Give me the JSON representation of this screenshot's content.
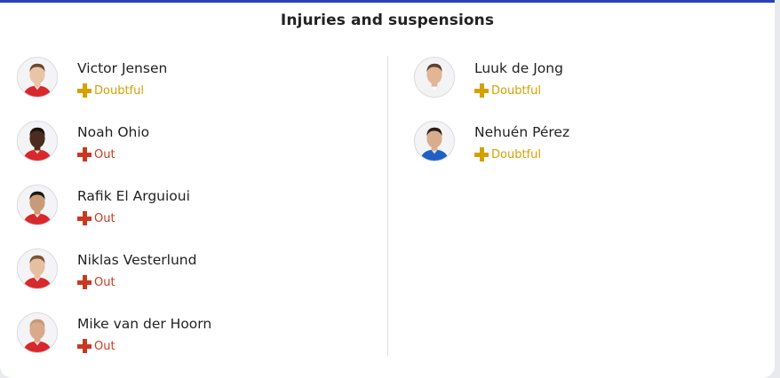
{
  "title": "Injuries and suspensions",
  "colors": {
    "doubtful": "#d4a100",
    "out": "#c73a22"
  },
  "left_players": [
    {
      "name": "Victor Jensen",
      "status": "Doubtful",
      "type": "doubtful",
      "skin": "#e9c4a8",
      "hair": "#6a4a2c",
      "kit": "#d8282c"
    },
    {
      "name": "Noah Ohio",
      "status": "Out",
      "type": "out",
      "skin": "#4a2d1f",
      "hair": "#1b120c",
      "kit": "#d8282c"
    },
    {
      "name": "Rafik El Arguioui",
      "status": "Out",
      "type": "out",
      "skin": "#c99a77",
      "hair": "#1e1612",
      "kit": "#d8282c"
    },
    {
      "name": "Niklas Vesterlund",
      "status": "Out",
      "type": "out",
      "skin": "#e6bfa2",
      "hair": "#7a5634",
      "kit": "#d8282c"
    },
    {
      "name": "Mike van der Hoorn",
      "status": "Out",
      "type": "out",
      "skin": "#d9a98a",
      "hair": "#c59a76",
      "kit": "#d8282c"
    }
  ],
  "right_players": [
    {
      "name": "Luuk de Jong",
      "status": "Doubtful",
      "type": "doubtful",
      "skin": "#e2b596",
      "hair": "#5a4230",
      "kit": "#f2f2f2"
    },
    {
      "name": "Nehuén Pérez",
      "status": "Doubtful",
      "type": "doubtful",
      "skin": "#d9ad8c",
      "hair": "#2a1d16",
      "kit": "#1f5fc4"
    }
  ]
}
